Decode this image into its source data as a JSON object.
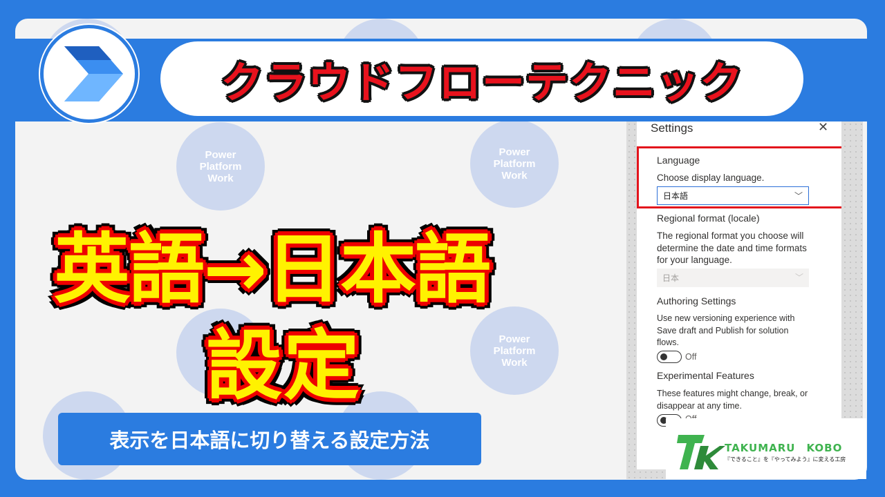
{
  "header": {
    "title": "クラウドフローテクニック"
  },
  "background_bubbles": [
    {
      "label": "Power\nPlatform\nWork"
    },
    {
      "label": "Power\nPlatform\nWork"
    },
    {
      "label": "Power\nPlatform\nWork"
    }
  ],
  "headline": {
    "line1": "英語→日本語",
    "line2": "設定"
  },
  "subtitle": "表示を日本語に切り替える設定方法",
  "settings_panel": {
    "title": "Settings",
    "close_glyph": "✕",
    "language": {
      "heading": "Language",
      "description": "Choose display language.",
      "selected": "日本語"
    },
    "regional": {
      "heading": "Regional format (locale)",
      "description": "The regional format you choose will determine the date and time formats for your language.",
      "selected": "日本"
    },
    "authoring": {
      "heading": "Authoring Settings",
      "description": "Use new versioning experience with Save draft and Publish for solution flows.",
      "toggle_state": "Off"
    },
    "experimental": {
      "heading": "Experimental Features",
      "description": "These features might change, break, or disappear at any time.",
      "toggle_state": "Off"
    }
  },
  "brand": {
    "name": "TAKUMARU　KOBO",
    "tagline": "『できること』を『やってみよう』に変える工房"
  },
  "colors": {
    "primary_blue": "#2b7ce0",
    "title_red": "#e8121d",
    "headline_yellow": "#fff200",
    "highlight_red": "#e3141c",
    "brand_green": "#3fb34f"
  }
}
